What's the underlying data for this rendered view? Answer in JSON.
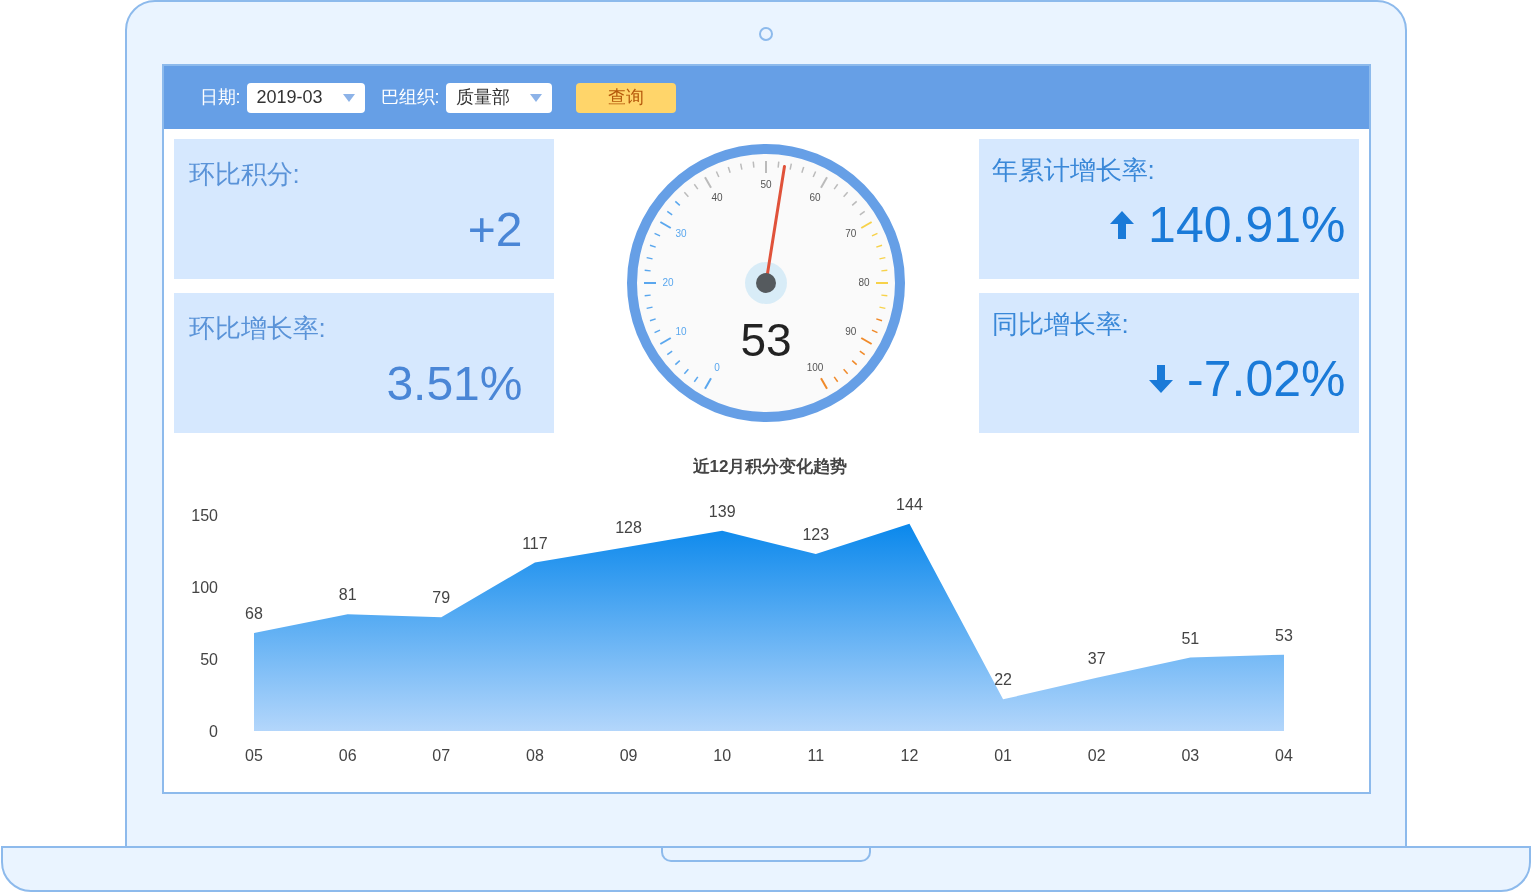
{
  "filters": [
    {
      "label": "日期:",
      "value": "2019-03"
    },
    {
      "label": "巴组织:",
      "value": "质量部"
    }
  ],
  "query_button": "查询",
  "left_cards": [
    {
      "title": "环比积分:",
      "value": "+2"
    },
    {
      "title": "环比增长率:",
      "value": "3.51%"
    }
  ],
  "gauge": {
    "value": "53",
    "scale_labels": [
      "0",
      "10",
      "20",
      "30",
      "40",
      "50",
      "60",
      "70",
      "80",
      "90",
      "100"
    ]
  },
  "right_cards": [
    {
      "title": "年累计增长率:",
      "value": "140.91%",
      "kind": "up"
    },
    {
      "title": "同比增长率:",
      "value": "-7.02%",
      "kind": "down"
    }
  ],
  "chart": {
    "chart_data": {
      "type": "area",
      "title": "近12月积分变化趋势",
      "categories": [
        "05",
        "06",
        "07",
        "08",
        "09",
        "10",
        "11",
        "12",
        "01",
        "02",
        "03",
        "04"
      ],
      "ylim": [
        0,
        150
      ],
      "yticks": [
        0,
        50,
        100,
        150
      ],
      "data_labels": true,
      "series": [
        {
          "color": "#0a88ec",
          "values": [
            68,
            81,
            79,
            117,
            128,
            139,
            123,
            144,
            22,
            37,
            51,
            53
          ]
        }
      ]
    }
  }
}
